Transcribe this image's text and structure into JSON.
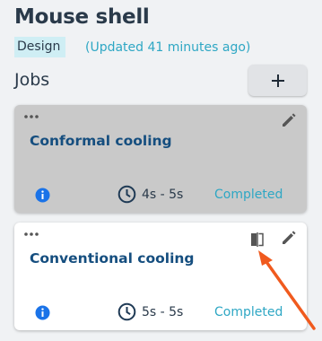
{
  "header": {
    "title": "Mouse shell",
    "tag": "Design",
    "updated": "(Updated 41 minutes ago)"
  },
  "jobs": {
    "label": "Jobs",
    "add_label": "+"
  },
  "cards": [
    {
      "name": "Conformal cooling",
      "duration": "4s - 5s",
      "status": "Completed",
      "selected": true
    },
    {
      "name": "Conventional cooling",
      "duration": "5s - 5s",
      "status": "Completed",
      "selected": false
    }
  ],
  "colors": {
    "title": "#2a3a4a",
    "accent": "#2ea7c4",
    "card_title": "#154e7f",
    "info_blue": "#1a73e8",
    "annotation_arrow": "#f05a1e",
    "selected_card": "#c9c9c9"
  },
  "icons": [
    "more-dots-icon",
    "pencil-icon",
    "compare-icon",
    "info-icon",
    "clock-icon",
    "plus-icon"
  ]
}
